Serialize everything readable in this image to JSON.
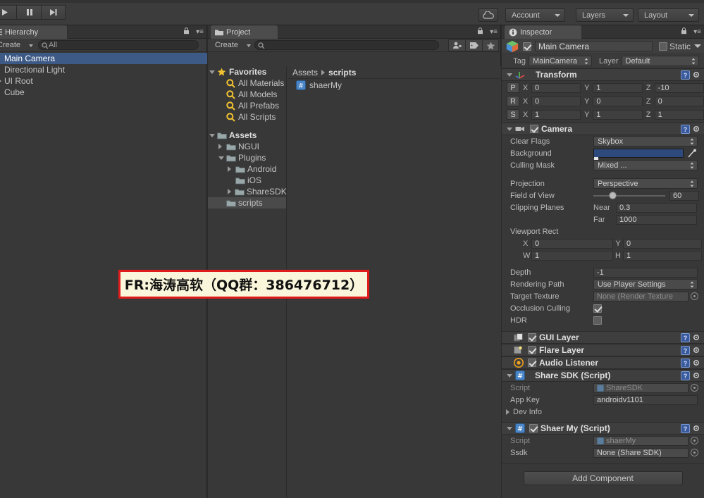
{
  "toolbar": {
    "play_icon": "play-icon",
    "pause_icon": "pause-icon",
    "step_icon": "step-icon",
    "cloud_icon": "cloud-icon",
    "account_label": "Account",
    "layers_label": "Layers",
    "layout_label": "Layout"
  },
  "hierarchy": {
    "tab_label": "Hierarchy",
    "create_label": "Create",
    "search_value": "All",
    "search_icon": "search-icon",
    "items": [
      {
        "label": "Main Camera",
        "selected": true,
        "expandable": false
      },
      {
        "label": "Directional Light",
        "selected": false,
        "expandable": false
      },
      {
        "label": "UI Root",
        "selected": false,
        "expandable": true
      },
      {
        "label": "Cube",
        "selected": false,
        "expandable": false
      }
    ]
  },
  "project": {
    "tab_label": "Project",
    "create_label": "Create",
    "search_value": "",
    "tools": [
      "avatar-filter-icon",
      "label-tag-icon",
      "star-icon"
    ],
    "tree": [
      {
        "label": "Favorites",
        "indent": 0,
        "arrow": "down",
        "icon": "star-icon",
        "bold": true
      },
      {
        "label": "All Materials",
        "indent": 1,
        "arrow": "none",
        "icon": "search-icon",
        "bold": false
      },
      {
        "label": "All Models",
        "indent": 1,
        "arrow": "none",
        "icon": "search-icon",
        "bold": false
      },
      {
        "label": "All Prefabs",
        "indent": 1,
        "arrow": "none",
        "icon": "search-icon",
        "bold": false
      },
      {
        "label": "All Scripts",
        "indent": 1,
        "arrow": "none",
        "icon": "search-icon",
        "bold": false
      },
      {
        "label": "",
        "indent": 0,
        "arrow": "none",
        "icon": "none",
        "bold": false
      },
      {
        "label": "Assets",
        "indent": 0,
        "arrow": "down",
        "icon": "folder-icon",
        "bold": true
      },
      {
        "label": "NGUI",
        "indent": 1,
        "arrow": "right",
        "icon": "folder-icon",
        "bold": false
      },
      {
        "label": "Plugins",
        "indent": 1,
        "arrow": "down",
        "icon": "folder-icon",
        "bold": false
      },
      {
        "label": "Android",
        "indent": 2,
        "arrow": "right",
        "icon": "folder-icon",
        "bold": false
      },
      {
        "label": "iOS",
        "indent": 2,
        "arrow": "none",
        "icon": "folder-icon",
        "bold": false
      },
      {
        "label": "ShareSDK",
        "indent": 2,
        "arrow": "right",
        "icon": "folder-icon",
        "bold": false
      },
      {
        "label": "scripts",
        "indent": 1,
        "arrow": "none",
        "icon": "folder-icon",
        "bold": false,
        "selected": true
      }
    ],
    "breadcrumb": [
      "Assets",
      "scripts"
    ],
    "assets": [
      {
        "label": "shaerMy",
        "icon": "csharp-script-icon"
      }
    ]
  },
  "inspector": {
    "tab_label": "Inspector",
    "object": {
      "icon": "gameobject-cube-icon",
      "enabled": true,
      "name": "Main Camera",
      "static_label": "Static",
      "static_checked": false,
      "tag_label": "Tag",
      "tag_value": "MainCamera",
      "layer_label": "Layer",
      "layer_value": "Default"
    },
    "transform": {
      "title": "Transform",
      "icon": "transform-axis-icon",
      "rows": [
        {
          "key": "P",
          "x": "0",
          "y": "1",
          "z": "-10"
        },
        {
          "key": "R",
          "x": "0",
          "y": "0",
          "z": "0"
        },
        {
          "key": "S",
          "x": "1",
          "y": "1",
          "z": "1"
        }
      ],
      "axes": [
        "X",
        "Y",
        "Z"
      ]
    },
    "camera": {
      "title": "Camera",
      "icon": "camera-icon",
      "enabled": true,
      "clear_flags_label": "Clear Flags",
      "clear_flags_value": "Skybox",
      "background_label": "Background",
      "background_color": "#2e4a7d",
      "eyedropper_icon": "eyedropper-icon",
      "culling_mask_label": "Culling Mask",
      "culling_mask_value": "Mixed ...",
      "projection_label": "Projection",
      "projection_value": "Perspective",
      "fov_label": "Field of View",
      "fov_value": "60",
      "fov_percent": 22,
      "clipping_label": "Clipping Planes",
      "near_label": "Near",
      "near_value": "0.3",
      "far_label": "Far",
      "far_value": "1000",
      "viewport_label": "Viewport Rect",
      "viewport_x_label": "X",
      "viewport_x": "0",
      "viewport_y_label": "Y",
      "viewport_y": "0",
      "viewport_w_label": "W",
      "viewport_w": "1",
      "viewport_h_label": "H",
      "viewport_h": "1",
      "depth_label": "Depth",
      "depth_value": "-1",
      "rendering_path_label": "Rendering Path",
      "rendering_path_value": "Use Player Settings",
      "target_texture_label": "Target Texture",
      "target_texture_value": "None (Render Texture",
      "occlusion_label": "Occlusion Culling",
      "occlusion_checked": true,
      "hdr_label": "HDR",
      "hdr_checked": false
    },
    "small_components": [
      {
        "title": "GUI Layer",
        "icon": "gui-layer-icon",
        "enabled": true
      },
      {
        "title": "Flare Layer",
        "icon": "flare-layer-icon",
        "enabled": true
      },
      {
        "title": "Audio Listener",
        "icon": "audio-listener-icon",
        "enabled": true
      }
    ],
    "share_sdk": {
      "title": "Share SDK (Script)",
      "icon": "csharp-script-icon",
      "script_label": "Script",
      "script_value": "ShareSDK",
      "appkey_label": "App Key",
      "appkey_value": "androidv1101",
      "devinfo_label": "Dev Info"
    },
    "shaer_my": {
      "title": "Shaer My (Script)",
      "icon": "csharp-script-icon",
      "enabled": true,
      "script_label": "Script",
      "script_value": "shaerMy",
      "ssdk_label": "Ssdk",
      "ssdk_value": "None (Share SDK)"
    },
    "add_component_label": "Add Component"
  },
  "watermark": {
    "text": "FR:海涛高软（QQ群：386476712）",
    "border_color": "#e01b1b",
    "background_color": "#faf6dc"
  }
}
